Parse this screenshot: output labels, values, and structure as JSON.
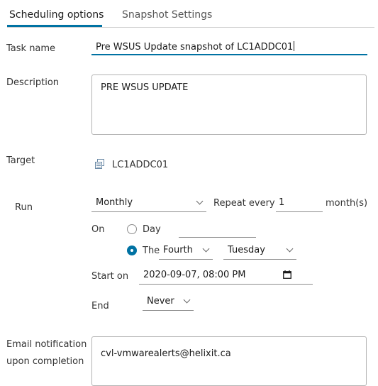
{
  "tabs": [
    {
      "label": "Scheduling options",
      "active": true
    },
    {
      "label": "Snapshot Settings",
      "active": false
    }
  ],
  "form": {
    "task_name_label": "Task name",
    "task_name_value": "Pre WSUS Update snapshot of LC1ADDC01",
    "description_label": "Description",
    "description_value": "PRE WSUS UPDATE",
    "target_label": "Target",
    "target_icon": "vm-icon",
    "target_value": "LC1ADDC01",
    "run_label": "Run",
    "run_frequency": "Monthly",
    "repeat_every_label": "Repeat every",
    "repeat_every_value": "1",
    "repeat_unit": "month(s)",
    "on_label": "On",
    "option_day_label": "Day",
    "option_day_value": "",
    "option_the_label": "The",
    "option_the_week": "Fourth",
    "option_the_weekday": "Tuesday",
    "selected_option": "the",
    "start_on_label": "Start on",
    "start_on_value": "2020-09-07, 08:00 PM",
    "end_label": "End",
    "end_value": "Never",
    "email_label_line1": "Email notification",
    "email_label_line2": "upon completion",
    "email_value": "cvl-vmwarealerts@helixit.ca"
  },
  "colors": {
    "accent": "#0072a3",
    "text": "#333333",
    "border": "#b3b3b3"
  }
}
